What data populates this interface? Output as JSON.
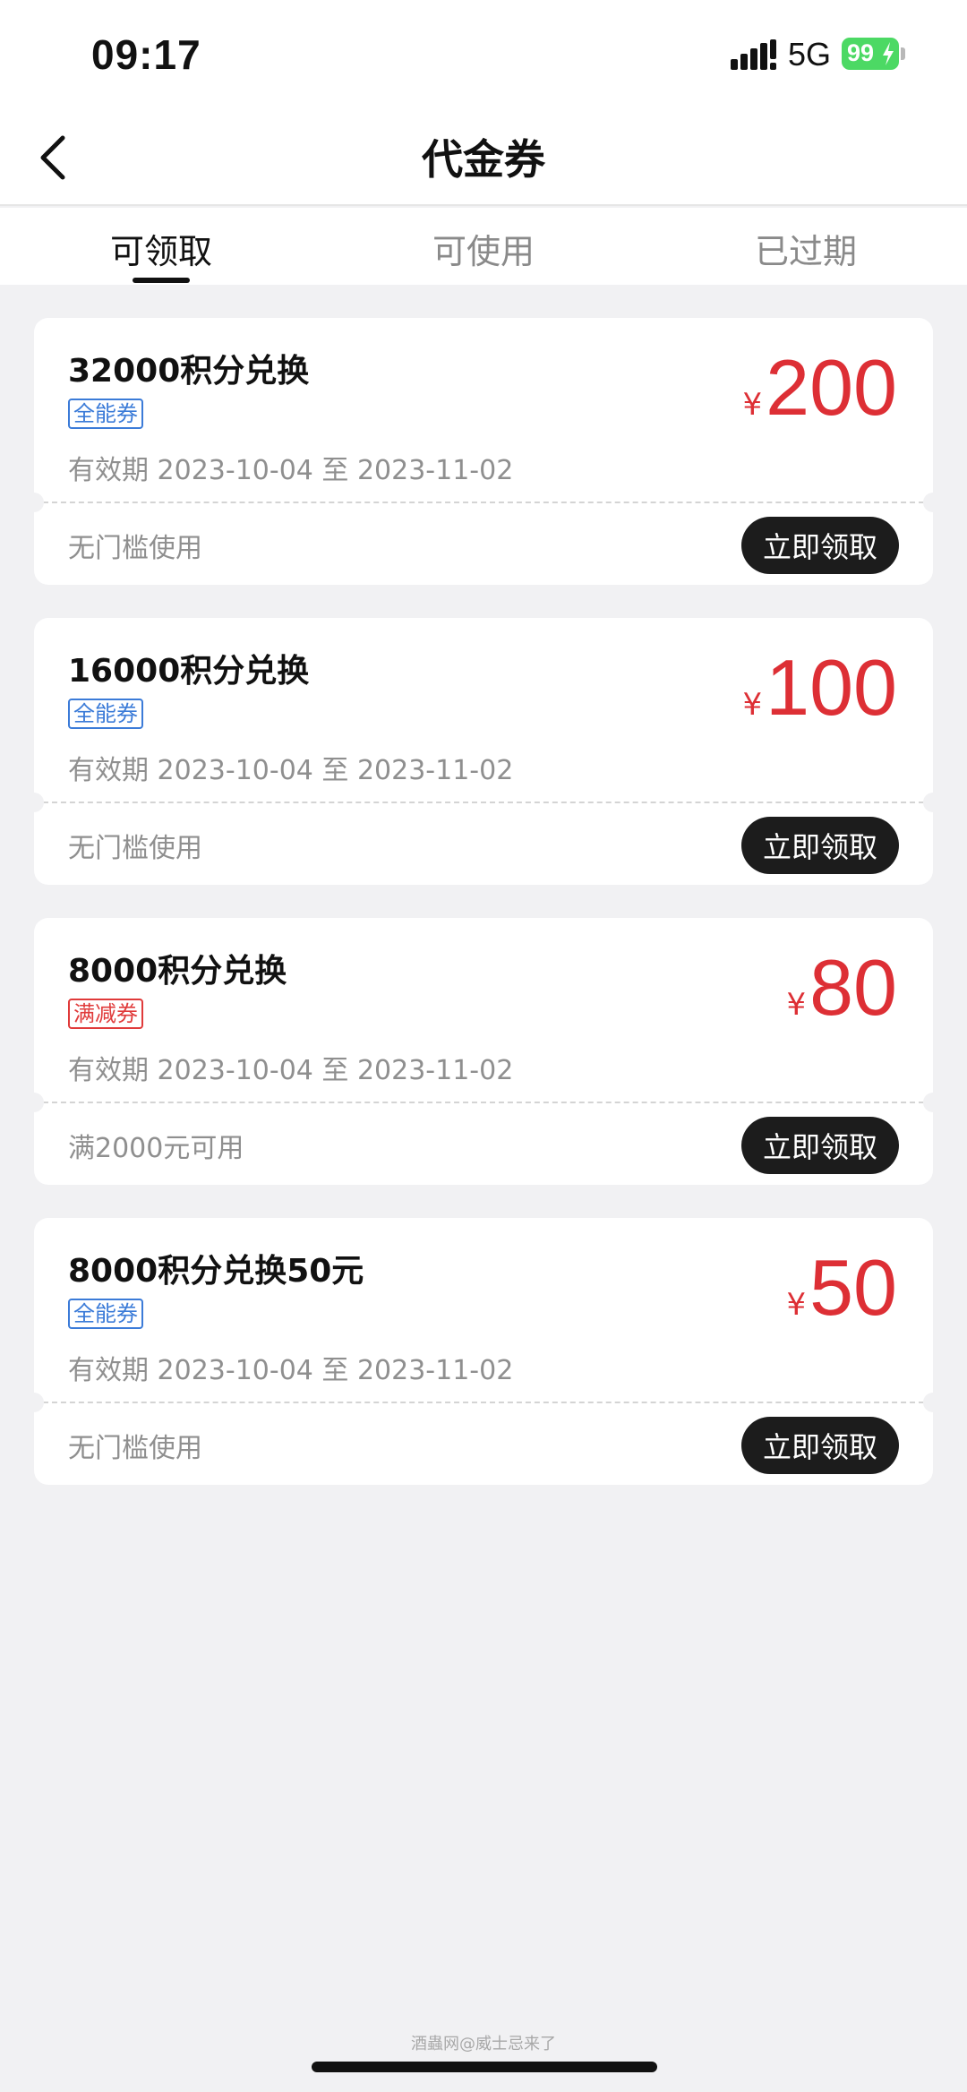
{
  "status_bar": {
    "time": "09:17",
    "network": "5G",
    "battery_level": "99",
    "battery_color": "#4cd964"
  },
  "nav": {
    "title": "代金券",
    "back_icon": "chevron-left-icon"
  },
  "tabs": [
    {
      "label": "可领取",
      "active": true
    },
    {
      "label": "可使用",
      "active": false
    },
    {
      "label": "已过期",
      "active": false
    }
  ],
  "coupons": [
    {
      "title": "32000积分兑换",
      "tag": "全能券",
      "tag_color": "#3b7bd8",
      "validity": "有效期 2023-10-04 至 2023-11-02",
      "currency": "¥",
      "amount": "200",
      "condition": "无门槛使用",
      "button_label": "立即领取"
    },
    {
      "title": "16000积分兑换",
      "tag": "全能券",
      "tag_color": "#3b7bd8",
      "validity": "有效期 2023-10-04 至 2023-11-02",
      "currency": "¥",
      "amount": "100",
      "condition": "无门槛使用",
      "button_label": "立即领取"
    },
    {
      "title": "8000积分兑换",
      "tag": "满减券",
      "tag_color": "#e03a3a",
      "validity": "有效期 2023-10-04 至 2023-11-02",
      "currency": "¥",
      "amount": "80",
      "condition": "满2000元可用",
      "button_label": "立即领取"
    },
    {
      "title": "8000积分兑换50元",
      "tag": "全能券",
      "tag_color": "#3b7bd8",
      "validity": "有效期 2023-10-04 至 2023-11-02",
      "currency": "¥",
      "amount": "50",
      "condition": "无门槛使用",
      "button_label": "立即领取"
    }
  ],
  "accent_color": "#dd2f35",
  "watermark": "酒蟲网@威士忌来了"
}
